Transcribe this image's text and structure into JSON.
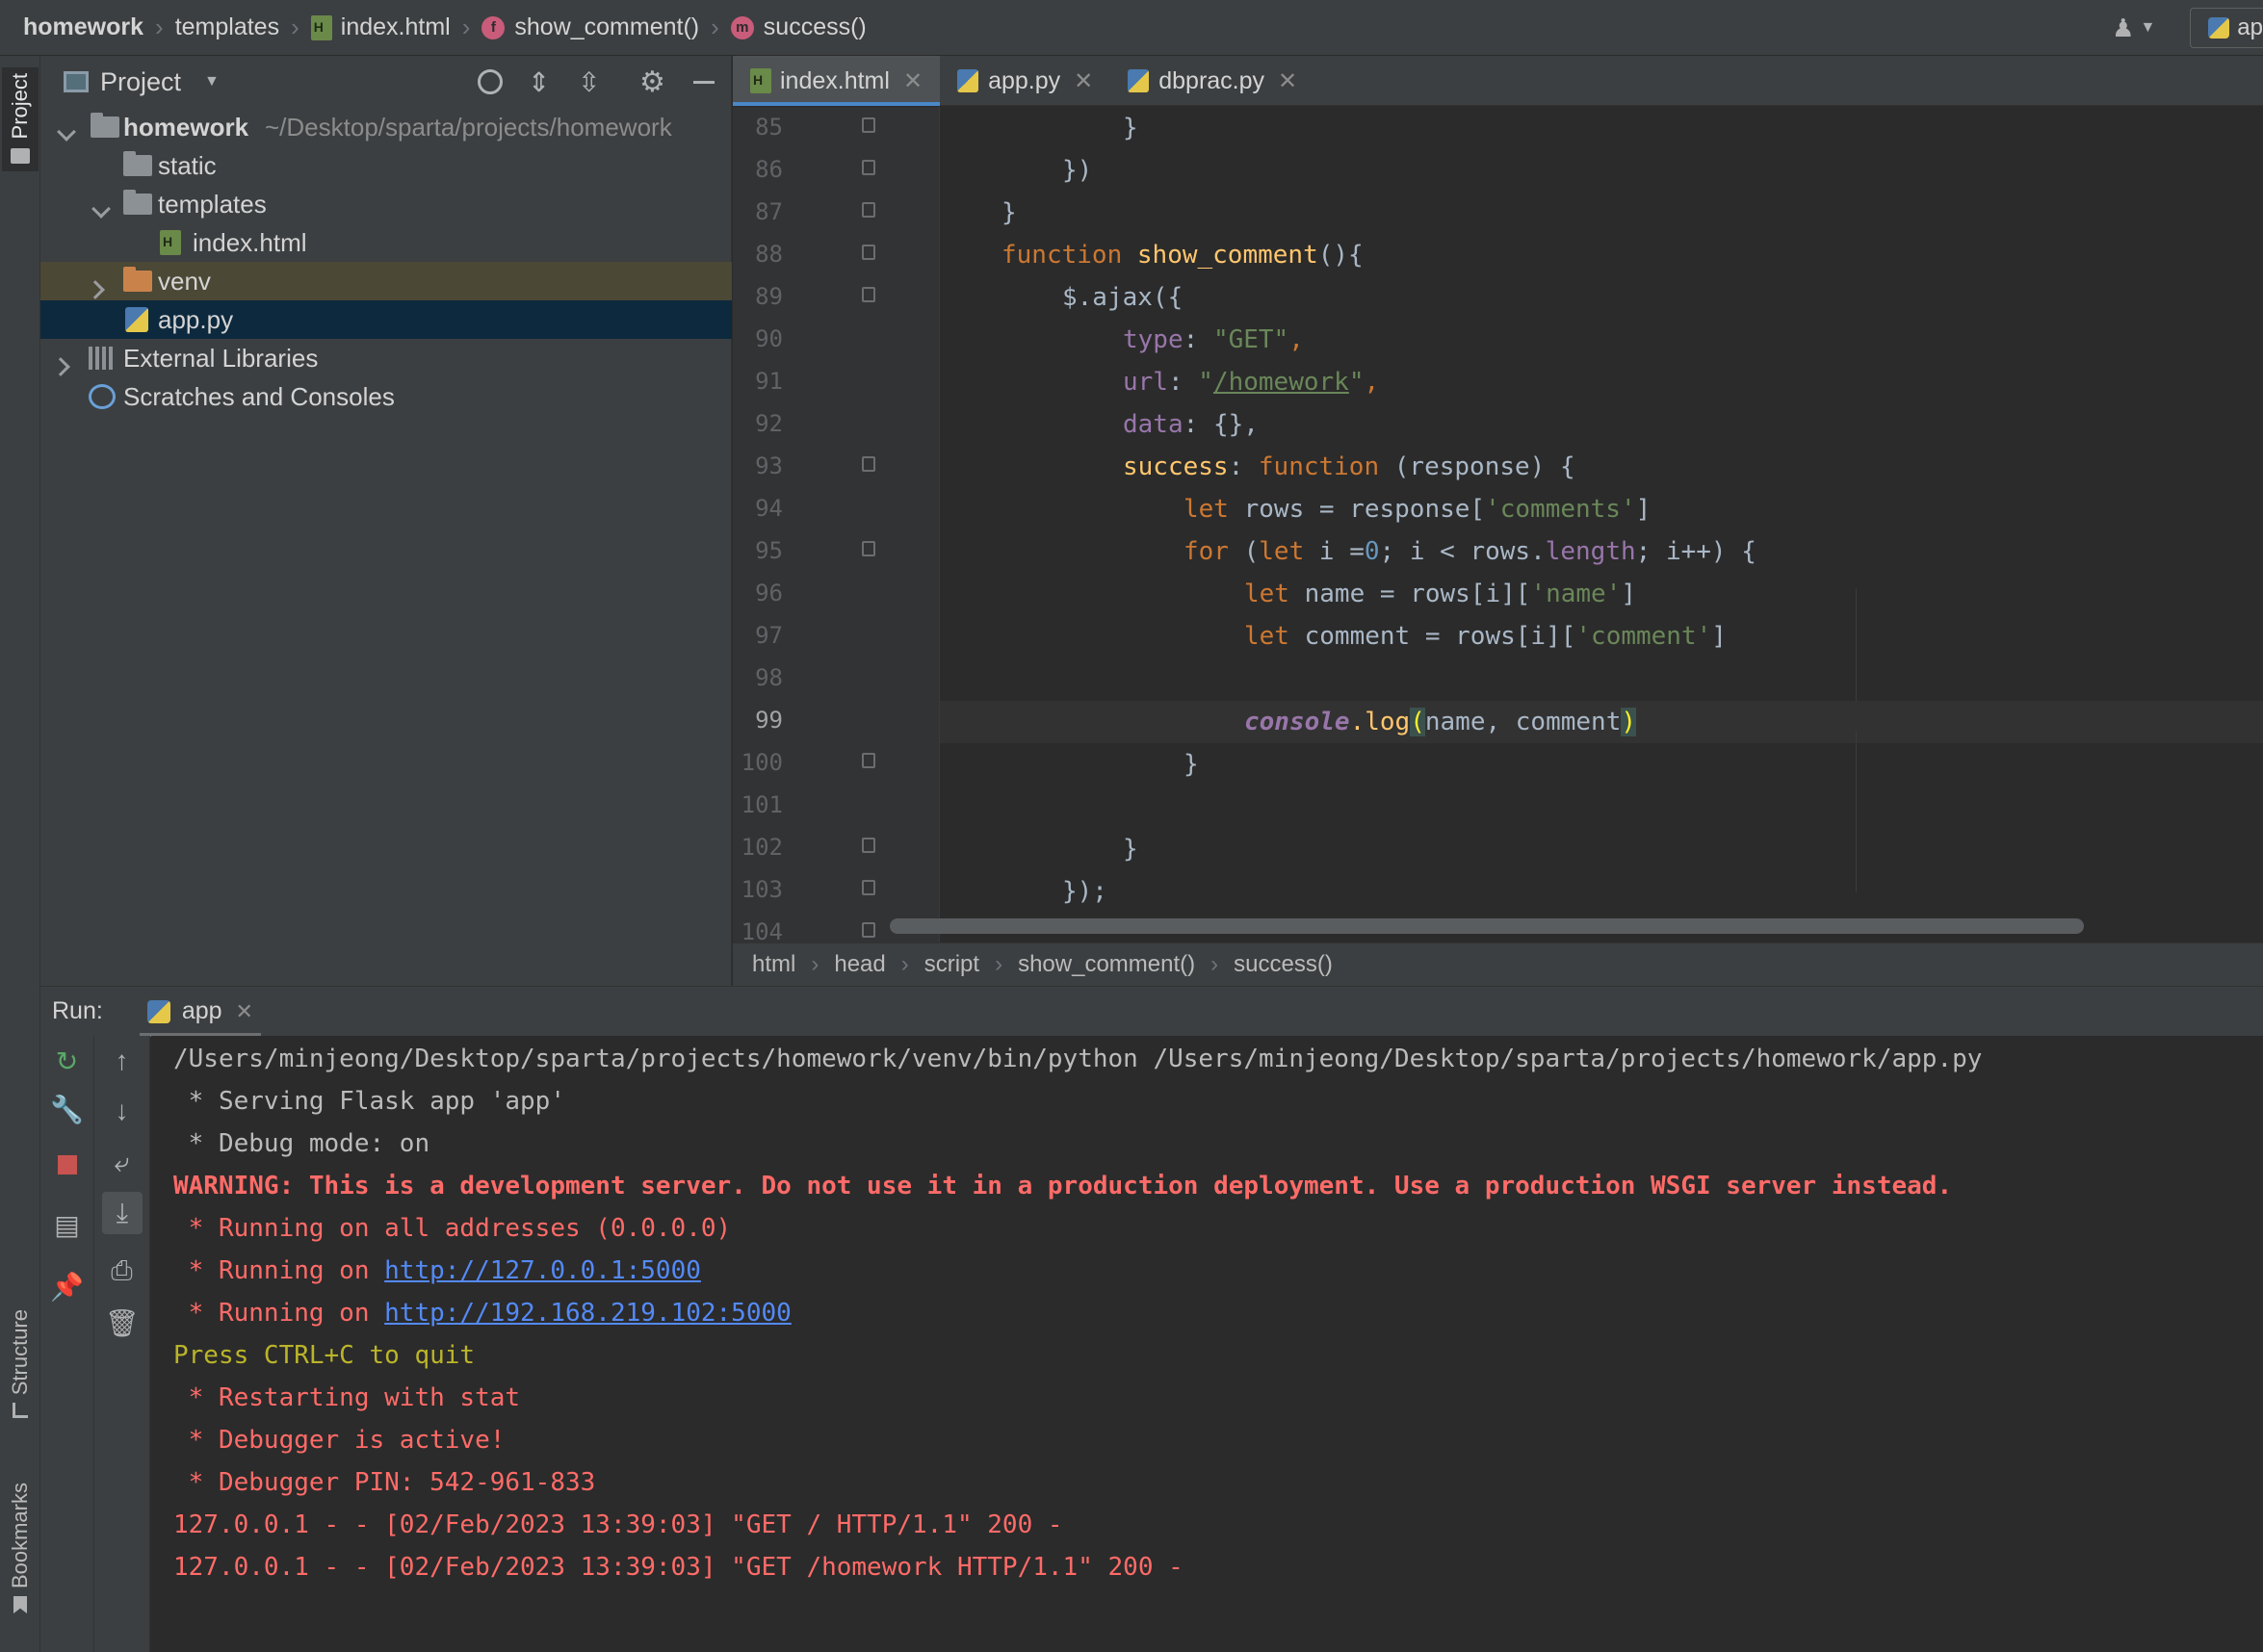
{
  "breadcrumb": [
    "homework",
    "templates",
    "index.html",
    "show_comment()",
    "success()"
  ],
  "top_right": {
    "run_config": "ap"
  },
  "tool_strip": {
    "project": "Project",
    "structure": "Structure",
    "bookmarks": "Bookmarks"
  },
  "project_panel": {
    "title": "Project",
    "tree": [
      {
        "name": "homework",
        "path": "~/Desktop/sparta/projects/homework"
      },
      {
        "name": "static"
      },
      {
        "name": "templates"
      },
      {
        "name": "index.html"
      },
      {
        "name": "venv"
      },
      {
        "name": "app.py"
      },
      {
        "name": "External Libraries"
      },
      {
        "name": "Scratches and Consoles"
      }
    ]
  },
  "editor_tabs": [
    {
      "label": "index.html",
      "active": true
    },
    {
      "label": "app.py",
      "active": false
    },
    {
      "label": "dbprac.py",
      "active": false
    }
  ],
  "line_numbers": [
    "85",
    "86",
    "87",
    "88",
    "89",
    "90",
    "91",
    "92",
    "93",
    "94",
    "95",
    "96",
    "97",
    "98",
    "99",
    "100",
    "101",
    "102",
    "103",
    "104"
  ],
  "code": {
    "l85": "}",
    "l86": "})",
    "l87": "}",
    "l88_kw": "function",
    "l88_fn": "show_comment",
    "l88_rest": "(){",
    "l89": "$.ajax({",
    "l90_key": "type",
    "l90_val": "\"GET\"",
    "l91_key": "url",
    "l91_q1": "\"",
    "l91_val": "/homework",
    "l91_q2": "\"",
    "l92_key": "data",
    "l92_rest": "{},",
    "l93_key": "success",
    "l93_kw": "function",
    "l93_rest": "(response) {",
    "l94_kw": "let",
    "l94_a": "rows = response[",
    "l94_str": "'comments'",
    "l94_b": "]",
    "l95_kw1": "for",
    "l95_a": "(",
    "l95_kw2": "let",
    "l95_b": "i =",
    "l95_num": "0",
    "l95_c": "; i < rows.",
    "l95_prop": "length",
    "l95_d": "; i++) {",
    "l96_kw": "let",
    "l96_a": "name = rows[i][",
    "l96_str": "'name'",
    "l96_b": "]",
    "l97_kw": "let",
    "l97_a": "comment = rows[i][",
    "l97_str": "'comment'",
    "l97_b": "]",
    "l99_obj": "console",
    "l99_fn": ".log",
    "l99_p1": "(",
    "l99_args": "name, comment",
    "l99_p2": ")",
    "l100": "}",
    "l102": "}",
    "l103": "});"
  },
  "editor_breadcrumb": [
    "html",
    "head",
    "script",
    "show_comment()",
    "success()"
  ],
  "run": {
    "label": "Run:",
    "config": "app"
  },
  "console": [
    {
      "text": "/Users/minjeong/Desktop/sparta/projects/homework/venv/bin/python /Users/minjeong/Desktop/sparta/projects/homework/app.py",
      "type": "normal"
    },
    {
      "text": " * Serving Flask app 'app'",
      "type": "normal"
    },
    {
      "text": " * Debug mode: on",
      "type": "normal"
    },
    {
      "text": "WARNING: This is a development server. Do not use it in a production deployment. Use a production WSGI server instead.",
      "type": "warning-bold"
    },
    {
      "text": " * Running on all addresses (0.0.0.0)",
      "type": "err"
    },
    {
      "prefix": " * Running on ",
      "link": "http://127.0.0.1:5000",
      "type": "err-link"
    },
    {
      "prefix": " * Running on ",
      "link": "http://192.168.219.102:5000",
      "type": "err-link"
    },
    {
      "text": "Press CTRL+C to quit",
      "type": "warn"
    },
    {
      "text": " * Restarting with stat",
      "type": "err"
    },
    {
      "text": " * Debugger is active!",
      "type": "err"
    },
    {
      "text": " * Debugger PIN: 542-961-833",
      "type": "err"
    },
    {
      "text": "127.0.0.1 - - [02/Feb/2023 13:39:03] \"GET / HTTP/1.1\" 200 -",
      "type": "err"
    },
    {
      "text": "127.0.0.1 - - [02/Feb/2023 13:39:03] \"GET /homework HTTP/1.1\" 200 -",
      "type": "err"
    }
  ],
  "colors": {
    "accent": "#4a88c7",
    "error_text": "#ff6b68",
    "warn_text": "#bbb529",
    "link": "#548af7",
    "selection": "#0d293e",
    "highlight": "#4c4836"
  }
}
